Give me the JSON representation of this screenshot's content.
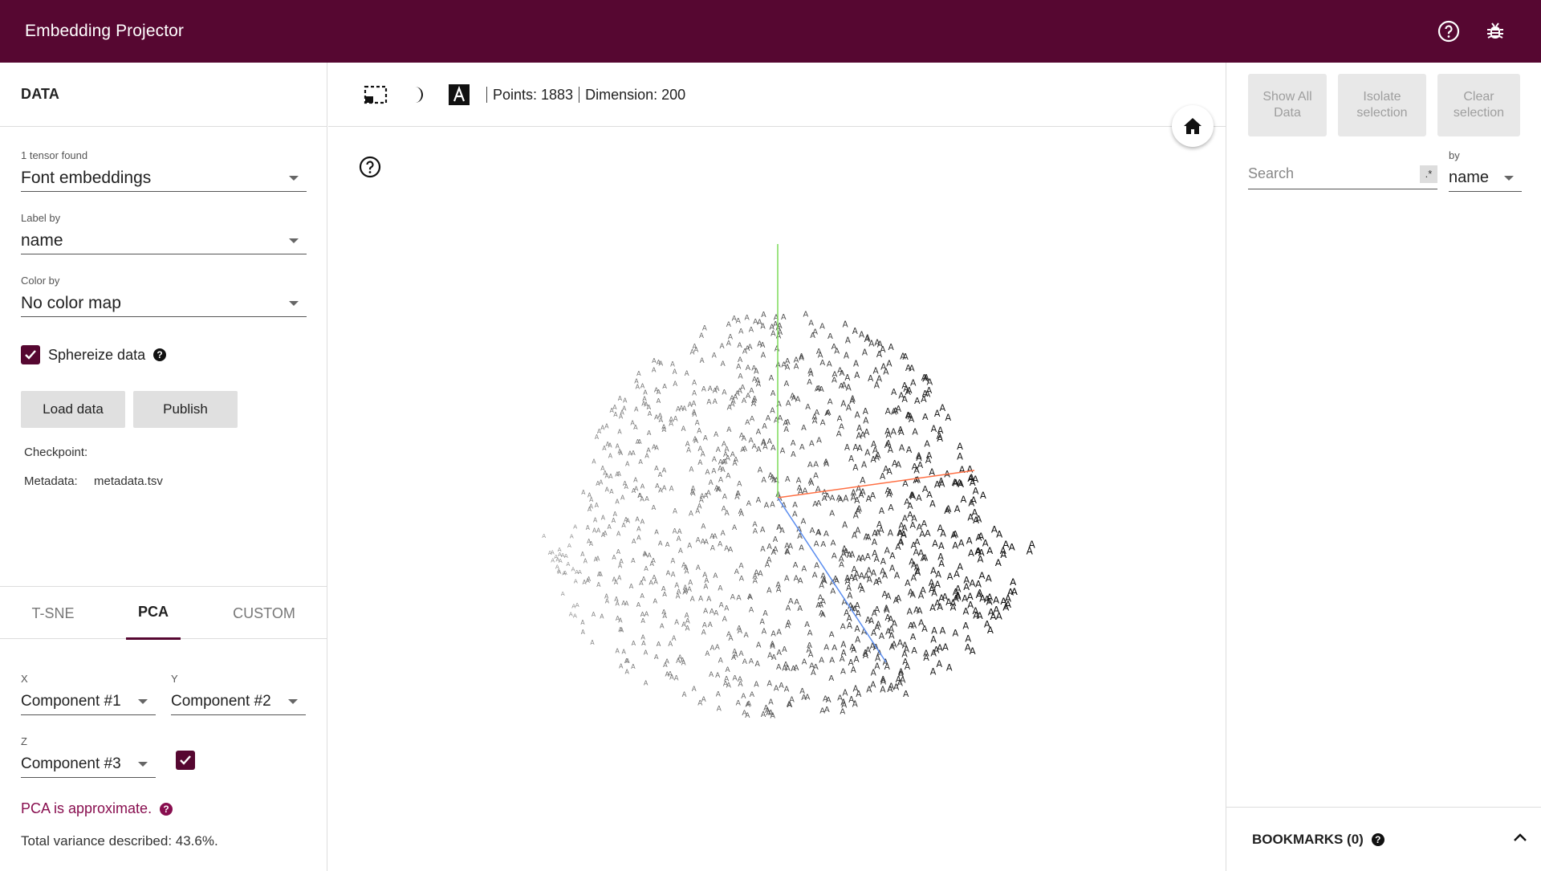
{
  "app": {
    "title": "Embedding Projector"
  },
  "left": {
    "header": "DATA",
    "tensor_label": "1 tensor found",
    "tensor_value": "Font embeddings",
    "label_by_label": "Label by",
    "label_by_value": "name",
    "color_by_label": "Color by",
    "color_by_value": "No color map",
    "sphereize_label": "Sphereize data",
    "sphereize_checked": true,
    "load_button": "Load data",
    "publish_button": "Publish",
    "checkpoint_label": "Checkpoint:",
    "metadata_label": "Metadata:",
    "metadata_value": "metadata.tsv",
    "tabs": [
      "T-SNE",
      "PCA",
      "CUSTOM"
    ],
    "active_tab": "PCA",
    "x_label": "X",
    "x_value": "Component #1",
    "y_label": "Y",
    "y_value": "Component #2",
    "z_label": "Z",
    "z_value": "Component #3",
    "z_checked": true,
    "pca_note": "PCA is approximate.",
    "variance_text": "Total variance described: 43.6%."
  },
  "center": {
    "points_text": "Points: 1883",
    "dimension_text": "Dimension: 200",
    "point_glyph": "A"
  },
  "right": {
    "show_all": "Show All Data",
    "isolate": "Isolate selection",
    "clear": "Clear selection",
    "search_placeholder": "Search",
    "regex_label": ".*",
    "by_label": "by",
    "by_value": "name",
    "bookmarks_label": "BOOKMARKS (0)"
  },
  "colors": {
    "brand": "#560731",
    "accent": "#880e4f",
    "axis_x": "#ff6f43",
    "axis_y": "#7ddc5a",
    "axis_z": "#5b8def"
  }
}
